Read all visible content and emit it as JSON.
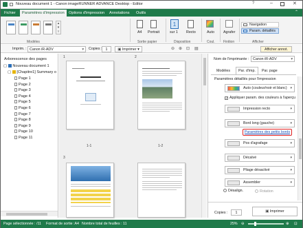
{
  "title": "Nouveau document 1 - Canon imageRUNNER ADVANCE Desktop - Editor",
  "ribbon_tabs": [
    "Fichier",
    "Paramètres d'impression",
    "Options d'impression",
    "Annotations",
    "Outils"
  ],
  "ribbon": {
    "modeles_label": "Modèles",
    "a4": "A4",
    "portrait": "Portrait",
    "sur1": "sur 1",
    "recto": "Recto",
    "auto": "Auto",
    "agrafer": "Agrafer",
    "sortie_papier": "Sortie papier",
    "disposition": "Disposition",
    "coul": "Coul.",
    "finition": "Finition",
    "afficher": "Afficher",
    "navigation": "Navigation",
    "param_details": "Param. détaillés"
  },
  "toolbar": {
    "imprim_label": "Imprim. :",
    "printer": "Canon iR-ADV",
    "copies_label": "Copies :",
    "copies_value": "1",
    "imprimer": "Imprimer",
    "afficher_annot": "Afficher annot."
  },
  "tree": {
    "header": "Arborescence des pages",
    "root": "Nouveau document 1",
    "chapter": "[Chapitre1] Summary o",
    "pages": [
      "Page 1",
      "Page 2",
      "Page 3",
      "Page 4",
      "Page 5",
      "Page 6",
      "Page 7",
      "Page 8",
      "Page 9",
      "Page 10",
      "Page 11"
    ]
  },
  "preview": {
    "page_labels": [
      "1-1",
      "1-2"
    ],
    "sheet_numbers": [
      "1",
      "2",
      "3"
    ]
  },
  "right": {
    "printer_label": "Nom de l'imprimante :",
    "printer": "Canon iR-ADV",
    "tabs": [
      "Modèles",
      "Par. d'imp.",
      "Par. page"
    ],
    "section": "Paramètres détaillés pour l'impression",
    "color_mode": "Auto (couleur/noir et blanc)",
    "apply_color": "Appliquer param. des couleurs à l'aperçu",
    "print_side": "Impression recto",
    "binding": "Bord long (gauche)",
    "small_margins": "Paramètres des petits bords",
    "staple_pos": "Pos d'agrafage",
    "offset": "Décalvé",
    "fold": "Pliage désactivé",
    "assemble": "Assembler",
    "desalign": "Désalign.",
    "rotation": "Rotation",
    "copies_label": "Copies :",
    "copies_value": "1",
    "imprimer": "Imprimer"
  },
  "status": {
    "selected_page": "Page sélectionnée : /11",
    "output_format": "Format de sortie :A4",
    "total_sheets": "Nombre total de feuilles : 11",
    "zoom": "25%"
  },
  "colors": {
    "accent": "#1f7a4a",
    "highlight": "#e02020"
  }
}
